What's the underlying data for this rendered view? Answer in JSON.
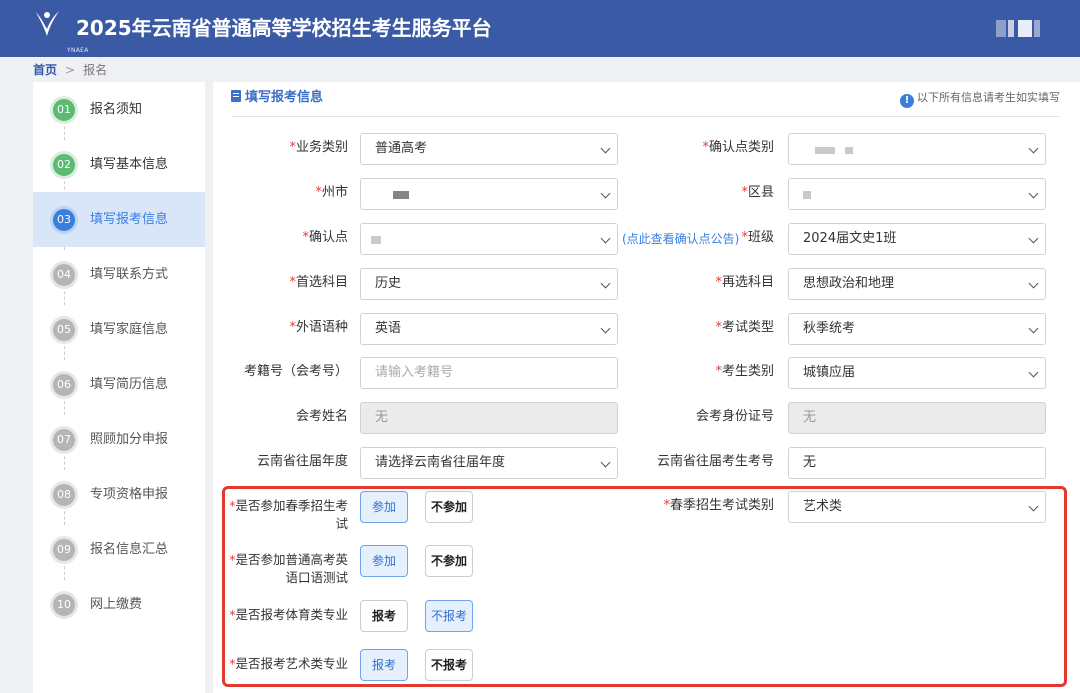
{
  "header": {
    "title": "2025年云南省普通高等学校招生考生服务平台",
    "logo_text": "YNAEA"
  },
  "breadcrumb": {
    "home": "首页",
    "separator": ">",
    "current": "报名"
  },
  "steps": [
    {
      "num": "01",
      "label": "报名须知",
      "state": "done"
    },
    {
      "num": "02",
      "label": "填写基本信息",
      "state": "done"
    },
    {
      "num": "03",
      "label": "填写报考信息",
      "state": "active"
    },
    {
      "num": "04",
      "label": "填写联系方式",
      "state": "todo"
    },
    {
      "num": "05",
      "label": "填写家庭信息",
      "state": "todo"
    },
    {
      "num": "06",
      "label": "填写简历信息",
      "state": "todo"
    },
    {
      "num": "07",
      "label": "照顾加分申报",
      "state": "todo"
    },
    {
      "num": "08",
      "label": "专项资格申报",
      "state": "todo"
    },
    {
      "num": "09",
      "label": "报名信息汇总",
      "state": "todo"
    },
    {
      "num": "10",
      "label": "网上缴费",
      "state": "todo"
    }
  ],
  "section": {
    "title": "填写报考信息",
    "notice": "以下所有信息请考生如实填写"
  },
  "fields": {
    "business_type": {
      "label": "业务类别",
      "value": "普通高考"
    },
    "confirm_type": {
      "label": "确认点类别",
      "value": ""
    },
    "city": {
      "label": "州市",
      "value": ""
    },
    "county": {
      "label": "区县",
      "value": ""
    },
    "confirm_point": {
      "label": "确认点",
      "value": "",
      "link": "(点此查看确认点公告)"
    },
    "class": {
      "label": "班级",
      "value": "2024届文史1班"
    },
    "first_subject": {
      "label": "首选科目",
      "value": "历史"
    },
    "second_subject": {
      "label": "再选科目",
      "value": "思想政治和地理"
    },
    "language": {
      "label": "外语语种",
      "value": "英语"
    },
    "exam_type": {
      "label": "考试类型",
      "value": "秋季统考"
    },
    "student_no": {
      "label": "考籍号（会考号）",
      "placeholder": "请输入考籍号"
    },
    "student_category": {
      "label": "考生类别",
      "value": "城镇应届"
    },
    "hk_name": {
      "label": "会考姓名",
      "value": "无"
    },
    "hk_id": {
      "label": "会考身份证号",
      "value": "无"
    },
    "prev_year": {
      "label": "云南省往届年度",
      "value": "请选择云南省往届年度"
    },
    "prev_no": {
      "label": "云南省往届考生考号",
      "value": "无"
    }
  },
  "questions": {
    "spring_exam": {
      "label_line1": "是否参加春季招生考",
      "label_line2": "试",
      "yes": "参加",
      "no": "不参加",
      "selected": "yes"
    },
    "spring_category": {
      "label": "春季招生考试类别",
      "value": "艺术类"
    },
    "oral_english": {
      "label_line1": "是否参加普通高考英",
      "label_line2": "语口语测试",
      "yes": "参加",
      "no": "不参加",
      "selected": "yes"
    },
    "sports": {
      "label": "是否报考体育类专业",
      "yes": "报考",
      "no": "不报考",
      "selected": "no"
    },
    "arts": {
      "label": "是否报考艺术类专业",
      "yes": "报考",
      "no": "不报考",
      "selected": "yes"
    }
  },
  "required_mark": "*",
  "colors": {
    "header_bg": "#3b5aa5",
    "accent": "#3a7fe0",
    "done": "#5dba72",
    "highlight_border": "#e03b2e"
  }
}
